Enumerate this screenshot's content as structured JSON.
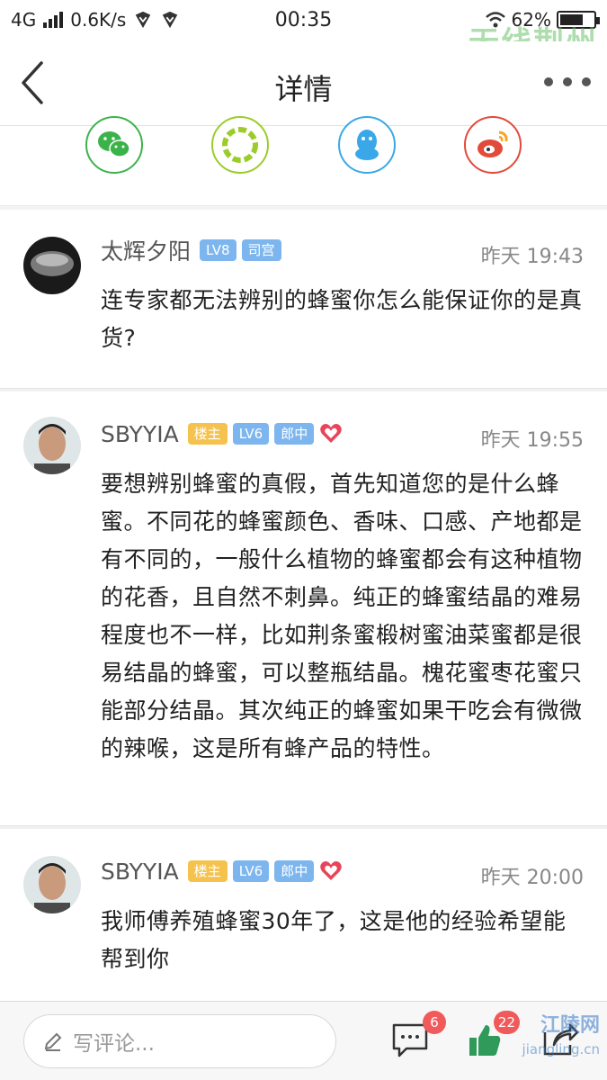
{
  "status_bar": {
    "network": "4G",
    "speed": "0.6K/s",
    "time": "00:35",
    "battery": "62%"
  },
  "watermark_top": "无线荆州",
  "header": {
    "title": "详情",
    "back_icon": "back-chevron-icon",
    "more_icon": "more-dots-icon"
  },
  "share": [
    {
      "name": "wechat",
      "icon": "wechat-icon",
      "color": "#3cb34a"
    },
    {
      "name": "moments",
      "icon": "moments-icon",
      "color": "#9ccc2a"
    },
    {
      "name": "qq",
      "icon": "qq-icon",
      "color": "#3aa8e8"
    },
    {
      "name": "weibo",
      "icon": "weibo-icon",
      "color": "#e24a3a"
    }
  ],
  "comments": [
    {
      "user": "太辉夕阳",
      "badges": [
        "LV8",
        "司宫"
      ],
      "time": "昨天 19:43",
      "text": "连专家都无法辨别的蜂蜜你怎么能保证你的是真货?"
    },
    {
      "user": "SBYYIA",
      "badges": [
        "楼主",
        "LV6",
        "郎中"
      ],
      "heart": true,
      "time": "昨天 19:55",
      "text": "要想辨别蜂蜜的真假，首先知道您的是什么蜂蜜。不同花的蜂蜜颜色、香味、口感、产地都是有不同的，一般什么植物的蜂蜜都会有这种植物的花香，且自然不刺鼻。纯正的蜂蜜结晶的难易程度也不一样，比如荆条蜜椴树蜜油菜蜜都是很易结晶的蜂蜜，可以整瓶结晶。槐花蜜枣花蜜只能部分结晶。其次纯正的蜂蜜如果干吃会有微微的辣喉，这是所有蜂产品的特性。"
    },
    {
      "user": "SBYYIA",
      "badges": [
        "楼主",
        "LV6",
        "郎中"
      ],
      "heart": true,
      "time": "昨天 20:00",
      "text": "我师傅养殖蜂蜜30年了，这是他的经验希望能帮到你"
    }
  ],
  "bottom": {
    "placeholder": "写评论...",
    "comment_count": "6",
    "like_count": "22",
    "watermark": "江陵网",
    "watermark_url": "jiangling.cn"
  },
  "colors": {
    "badge_owner": "#f5c24e",
    "badge_level": "#7db6ee",
    "heart": "#e8455a",
    "badge_red": "#f05a5a"
  }
}
